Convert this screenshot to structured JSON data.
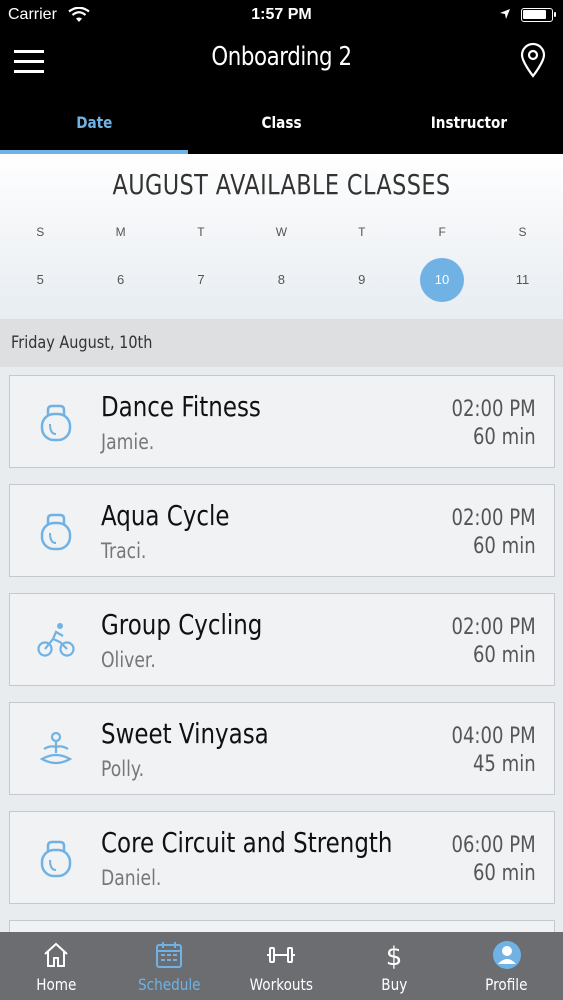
{
  "status_bar": {
    "carrier": "Carrier",
    "time": "1:57 PM",
    "battery_level": 0.85
  },
  "nav": {
    "title": "Onboarding 2",
    "menu_icon": "hamburger-menu-icon",
    "location_icon": "map-pin-icon"
  },
  "tabs": [
    {
      "label": "Date",
      "active": true
    },
    {
      "label": "Class",
      "active": false
    },
    {
      "label": "Instructor",
      "active": false
    }
  ],
  "calendar": {
    "title": "AUGUST AVAILABLE CLASSES",
    "days": [
      "S",
      "M",
      "T",
      "W",
      "T",
      "F",
      "S"
    ],
    "dates": [
      "5",
      "6",
      "7",
      "8",
      "9",
      "10",
      "11"
    ],
    "selected_date": "10"
  },
  "date_header": "Friday August, 10th",
  "classes": [
    {
      "name": "Dance Fitness",
      "instructor": "Jamie.",
      "time": "02:00 PM",
      "duration": "60 min",
      "icon": "kettlebell-icon"
    },
    {
      "name": "Aqua Cycle",
      "instructor": "Traci.",
      "time": "02:00 PM",
      "duration": "60 min",
      "icon": "kettlebell-icon"
    },
    {
      "name": "Group Cycling",
      "instructor": "Oliver.",
      "time": "02:00 PM",
      "duration": "60 min",
      "icon": "cyclist-icon"
    },
    {
      "name": "Sweet Vinyasa",
      "instructor": "Polly.",
      "time": "04:00 PM",
      "duration": "45 min",
      "icon": "meditation-icon"
    },
    {
      "name": "Core Circuit and Strength",
      "instructor": "Daniel.",
      "time": "06:00 PM",
      "duration": "60 min",
      "icon": "kettlebell-icon"
    }
  ],
  "tab_bar": [
    {
      "label": "Home",
      "icon": "home-icon",
      "active": false
    },
    {
      "label": "Schedule",
      "icon": "calendar-icon",
      "active": true
    },
    {
      "label": "Workouts",
      "icon": "dumbbell-icon",
      "active": false
    },
    {
      "label": "Buy",
      "icon": "dollar-icon",
      "active": false
    },
    {
      "label": "Profile",
      "icon": "profile-icon",
      "active": false
    }
  ],
  "colors": {
    "accent": "#6fb2e3",
    "bar_bg": "#000000",
    "tab_bar_bg": "#6b6d70"
  }
}
